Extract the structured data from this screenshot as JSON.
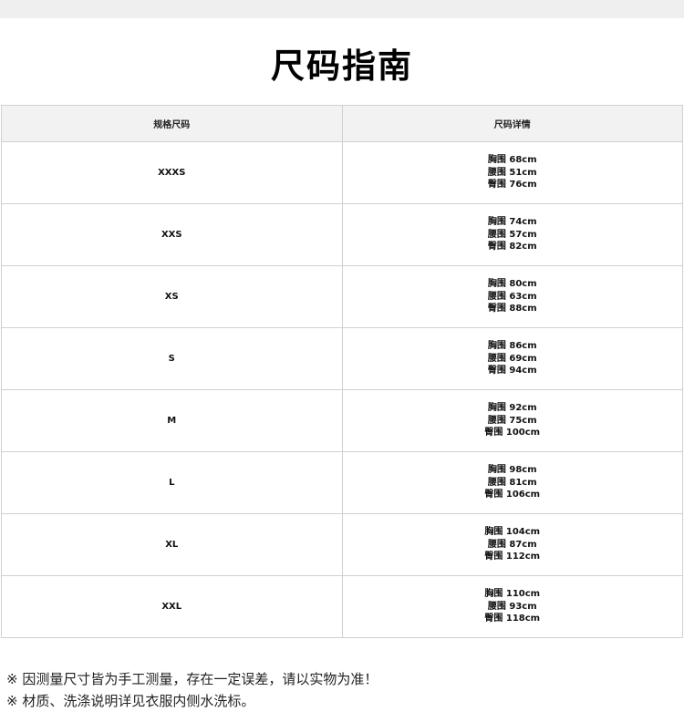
{
  "title": "尺码指南",
  "table": {
    "headers": [
      "规格尺码",
      "尺码详情"
    ],
    "rows": [
      {
        "size": "XXXS",
        "details": [
          "胸围 68cm",
          "腰围 51cm",
          "臀围 76cm"
        ]
      },
      {
        "size": "XXS",
        "details": [
          "胸围 74cm",
          "腰围 57cm",
          "臀围 82cm"
        ]
      },
      {
        "size": "XS",
        "details": [
          "胸围 80cm",
          "腰围 63cm",
          "臀围 88cm"
        ]
      },
      {
        "size": "S",
        "details": [
          "胸围 86cm",
          "腰围 69cm",
          "臀围 94cm"
        ]
      },
      {
        "size": "M",
        "details": [
          "胸围 92cm",
          "腰围 75cm",
          "臀围 100cm"
        ]
      },
      {
        "size": "L",
        "details": [
          "胸围 98cm",
          "腰围 81cm",
          "臀围 106cm"
        ]
      },
      {
        "size": "XL",
        "details": [
          "胸围 104cm",
          "腰围 87cm",
          "臀围 112cm"
        ]
      },
      {
        "size": "XXL",
        "details": [
          "胸围 110cm",
          "腰围 93cm",
          "臀围 118cm"
        ]
      }
    ]
  },
  "notes": [
    "※ 因测量尺寸皆为手工测量，存在一定误差，请以实物为准！",
    "※ 材质、洗涤说明详见衣服内侧水洗标。"
  ],
  "colors": {
    "header_bg": "#f2f2f2",
    "border": "#d0d0d0",
    "top_band": "#efefef"
  }
}
